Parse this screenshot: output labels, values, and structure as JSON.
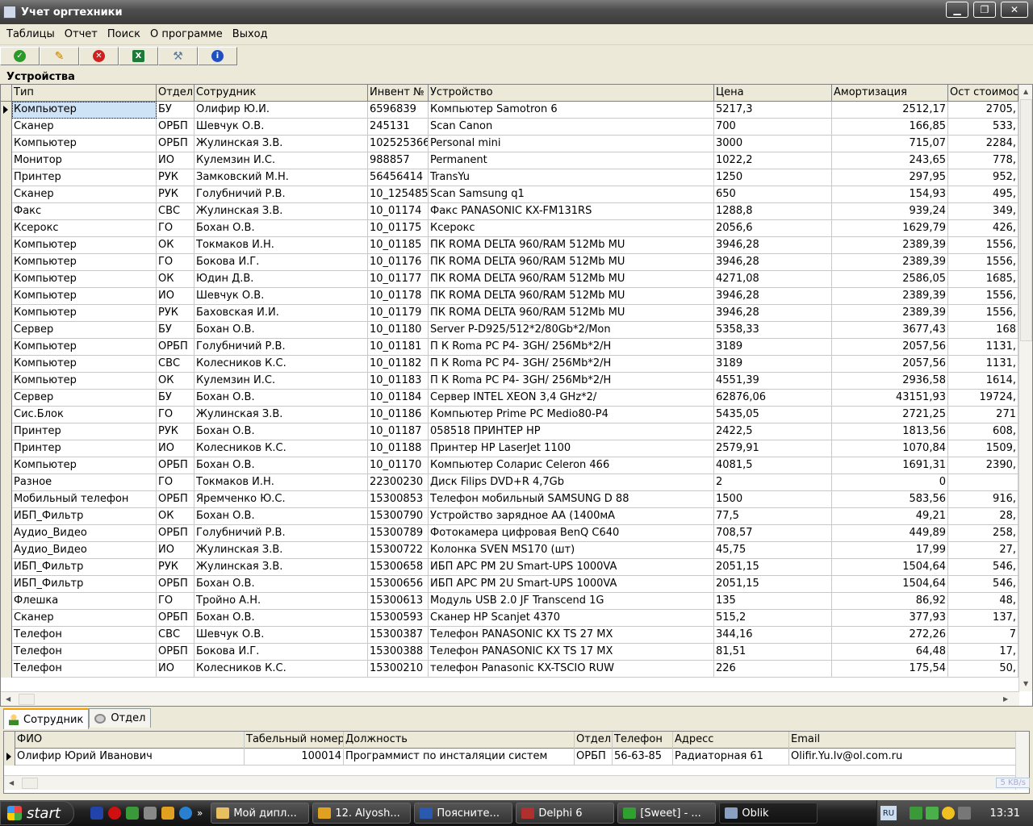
{
  "window": {
    "title": "Учет оргтехники",
    "min": "▁",
    "max": "❐",
    "close": "✕"
  },
  "menu": [
    "Таблицы",
    "Отчет",
    "Поиск",
    "О программе",
    "Выход"
  ],
  "toolbar": [
    {
      "icon": "check-icon",
      "color": "#2a9a2a"
    },
    {
      "icon": "pencil-icon",
      "color": "#e0b020"
    },
    {
      "icon": "delete-icon",
      "color": "#d02020"
    },
    {
      "icon": "excel-export-icon",
      "color": "#1f7a3a"
    },
    {
      "icon": "tools-icon",
      "color": "#6a8ab0"
    },
    {
      "icon": "info-icon",
      "color": "#2050c0"
    }
  ],
  "section_label": "Устройства",
  "devices": {
    "columns": [
      "Тип",
      "Отдел",
      "Сотрудник",
      "Инвент №",
      "Устройство",
      "Цена",
      "Амортизация",
      "Ост стоимос"
    ],
    "rows": [
      [
        "Компьютер",
        "БУ",
        "Олифир Ю.И.",
        "6596839",
        "Компьютер Samotron 6",
        "5217,3",
        "2512,17",
        "2705,"
      ],
      [
        "Сканер",
        "ОРБП",
        "Шевчук О.В.",
        "245131",
        "Scan Canon",
        "700",
        "166,85",
        "533,"
      ],
      [
        "Компьютер",
        "ОРБП",
        "Жулинская З.В.",
        "102525366",
        "Personal mini",
        "3000",
        "715,07",
        "2284,"
      ],
      [
        "Монитор",
        "ИО",
        "Кулемзин И.С.",
        "988857",
        "Permanent",
        "1022,2",
        "243,65",
        "778,"
      ],
      [
        "Принтер",
        "РУК",
        "Замковский М.Н.",
        "56456414",
        "TransYu",
        "1250",
        "297,95",
        "952,"
      ],
      [
        "Сканер",
        "РУК",
        "Голубничий Р.В.",
        "10_125485",
        "Scan Samsung q1",
        "650",
        "154,93",
        "495,"
      ],
      [
        "Факс",
        "СВС",
        "Жулинская З.В.",
        "10_01174",
        "Факс PANASONIC KX-FM131RS",
        "1288,8",
        "939,24",
        "349,"
      ],
      [
        "Ксерокс",
        "ГО",
        "Бохан О.В.",
        "10_01175",
        "Ксерокс",
        "2056,6",
        "1629,79",
        "426,"
      ],
      [
        "Компьютер",
        "ОК",
        "Токмаков И.Н.",
        "10_01185",
        "ПК ROMA DELTA 960/RAM 512Mb MU",
        "3946,28",
        "2389,39",
        "1556,"
      ],
      [
        "Компьютер",
        "ГО",
        "Бокова И.Г.",
        "10_01176",
        "ПК ROMA DELTA 960/RAM 512Mb MU",
        "3946,28",
        "2389,39",
        "1556,"
      ],
      [
        "Компьютер",
        "ОК",
        "Юдин Д.В.",
        "10_01177",
        "ПК ROMA DELTA 960/RAM 512Mb MU",
        "4271,08",
        "2586,05",
        "1685,"
      ],
      [
        "Компьютер",
        "ИО",
        "Шевчук О.В.",
        "10_01178",
        "ПК ROMA DELTA 960/RAM 512Mb MU",
        "3946,28",
        "2389,39",
        "1556,"
      ],
      [
        "Компьютер",
        "РУК",
        "Баховская И.И.",
        "10_01179",
        "ПК ROMA DELTA 960/RAM 512Mb MU",
        "3946,28",
        "2389,39",
        "1556,"
      ],
      [
        "Сервер",
        "БУ",
        "Бохан О.В.",
        "10_01180",
        "Server P-D925/512*2/80Gb*2/Mon",
        "5358,33",
        "3677,43",
        "168"
      ],
      [
        "Компьютер",
        "ОРБП",
        "Голубничий Р.В.",
        "10_01181",
        "П К Roma PC P4- 3GH/ 256Mb*2/H",
        "3189",
        "2057,56",
        "1131,"
      ],
      [
        "Компьютер",
        "СВС",
        "Колесников К.С.",
        "10_01182",
        "П К Roma PC P4- 3GH/ 256Mb*2/H",
        "3189",
        "2057,56",
        "1131,"
      ],
      [
        "Компьютер",
        "ОК",
        "Кулемзин И.С.",
        "10_01183",
        "П К Roma PC P4- 3GH/ 256Mb*2/H",
        "4551,39",
        "2936,58",
        "1614,"
      ],
      [
        "Сервер",
        "БУ",
        "Бохан О.В.",
        "10_01184",
        "Сервер INTEL XEON 3,4 GHz*2/",
        "62876,06",
        "43151,93",
        "19724,"
      ],
      [
        "Сис.Блок",
        "ГО",
        "Жулинская З.В.",
        "10_01186",
        "Компьютер Prime PC Medio80-P4",
        "5435,05",
        "2721,25",
        "271"
      ],
      [
        "Принтер",
        "РУК",
        "Бохан О.В.",
        "10_01187",
        "058518 ПРИНТЕР HP",
        "2422,5",
        "1813,56",
        "608,"
      ],
      [
        "Принтер",
        "ИО",
        "Колесников К.С.",
        "10_01188",
        "Принтер HP LaserJet 1100",
        "2579,91",
        "1070,84",
        "1509,"
      ],
      [
        "Компьютер",
        "ОРБП",
        "Бохан О.В.",
        "10_01170",
        "Компьютер Соларис Celeron 466",
        "4081,5",
        "1691,31",
        "2390,"
      ],
      [
        "Разное",
        "ГО",
        "Токмаков И.Н.",
        "22300230",
        "Диск Filips DVD+R 4,7Gb",
        "2",
        "0",
        ""
      ],
      [
        "Мобильный телефон",
        "ОРБП",
        "Яремченко Ю.С.",
        "15300853",
        "Телефон мобильный SAMSUNG D 88",
        "1500",
        "583,56",
        "916,"
      ],
      [
        "ИБП_Фильтр",
        "ОК",
        "Бохан О.В.",
        "15300790",
        "Устройство зарядное АА (1400мА",
        "77,5",
        "49,21",
        "28,"
      ],
      [
        "Аудио_Видео",
        "ОРБП",
        "Голубничий Р.В.",
        "15300789",
        "Фотокамера цифровая BenQ C640",
        "708,57",
        "449,89",
        "258,"
      ],
      [
        "Аудио_Видео",
        "ИО",
        "Жулинская З.В.",
        "15300722",
        "Колонка SVEN MS170 (шт)",
        "45,75",
        "17,99",
        "27,"
      ],
      [
        "ИБП_Фильтр",
        "РУК",
        "Жулинская З.В.",
        "15300658",
        "ИБП APC PM 2U Smart-UPS 1000VA",
        "2051,15",
        "1504,64",
        "546,"
      ],
      [
        "ИБП_Фильтр",
        "ОРБП",
        "Бохан О.В.",
        "15300656",
        "ИБП APC PM 2U Smart-UPS 1000VA",
        "2051,15",
        "1504,64",
        "546,"
      ],
      [
        "Флешка",
        "ГО",
        "Тройно А.Н.",
        "15300613",
        "Модуль USB 2.0 JF Transcend 1G",
        "135",
        "86,92",
        "48,"
      ],
      [
        "Сканер",
        "ОРБП",
        "Бохан О.В.",
        "15300593",
        "Сканер HP Scanjet 4370",
        "515,2",
        "377,93",
        "137,"
      ],
      [
        "Телефон",
        "СВС",
        "Шевчук О.В.",
        "15300387",
        "Телефон PANASONIC KX TS 27 MX",
        "344,16",
        "272,26",
        "7"
      ],
      [
        "Телефон",
        "ОРБП",
        "Бокова И.Г.",
        "15300388",
        "Телефон PANASONIC KX TS 17 MX",
        "81,51",
        "64,48",
        "17,"
      ],
      [
        "Телефон",
        "ИО",
        "Колесников К.С.",
        "15300210",
        "телефон Panasonic KX-TSCIO RUW",
        "226",
        "175,54",
        "50,"
      ]
    ]
  },
  "tabs": [
    "Сотрудник",
    "Отдел"
  ],
  "employees": {
    "columns": [
      "ФИО",
      "Табельный номер",
      "Должность",
      "Отдел",
      "Телефон",
      "Адресс",
      "Email"
    ],
    "rows": [
      [
        "Олифир Юрий Иванович",
        "100014",
        "Программист по инсталяции систем",
        "ОРБП",
        "56-63-85",
        "Радиаторная 61",
        "Olifir.Yu.lv@ol.com.ru"
      ]
    ]
  },
  "net_badge": "5 KB/s",
  "taskbar": {
    "start": "start",
    "more": "»",
    "tasks": [
      "Мой дипл...",
      "12. Alyosh...",
      "Поясните...",
      "Delphi 6",
      "[Sweet] - ...",
      "Oblik"
    ],
    "lang": "RU",
    "clock": "13:31"
  }
}
